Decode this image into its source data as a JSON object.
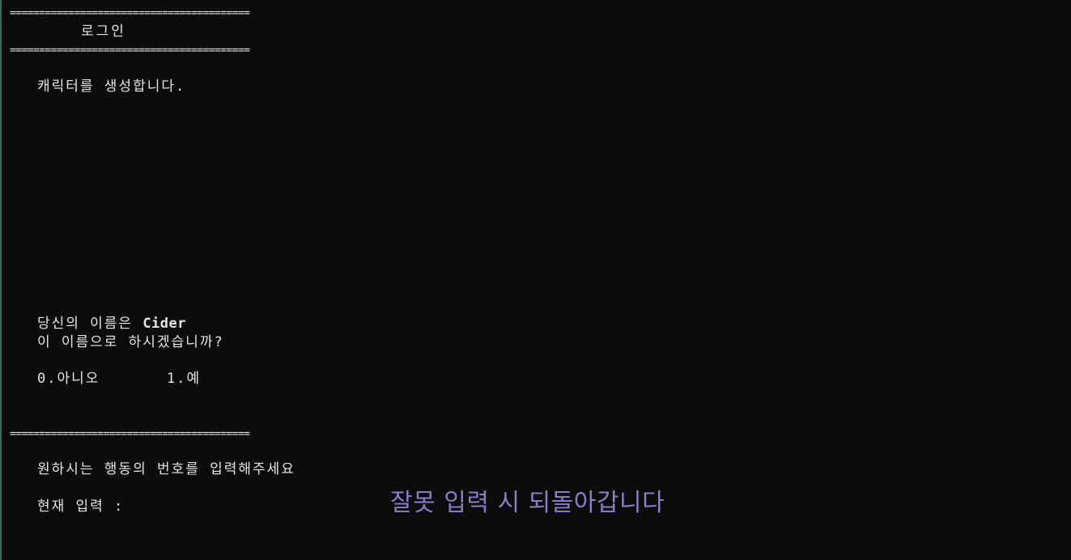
{
  "console": {
    "rule_line": "=========================================",
    "title": "로그인",
    "create_message": "캐릭터를 생성합니다.",
    "name_prefix": "당신의 이름은 ",
    "name_value": "Cider",
    "confirm_question": "이 이름으로 하시겠습니까?",
    "option_no": "0.아니오",
    "option_yes": "1.예",
    "prompt": "원하시는 행동의 번호를 입력해주세요",
    "input_label": "현재 입력 :",
    "input_value": ""
  },
  "annotation": {
    "text": "잘못 입력 시 되돌아갑니다",
    "color": "#8c7cc8"
  },
  "colors": {
    "background": "#0c0c0c",
    "foreground": "#e6e6e6"
  }
}
